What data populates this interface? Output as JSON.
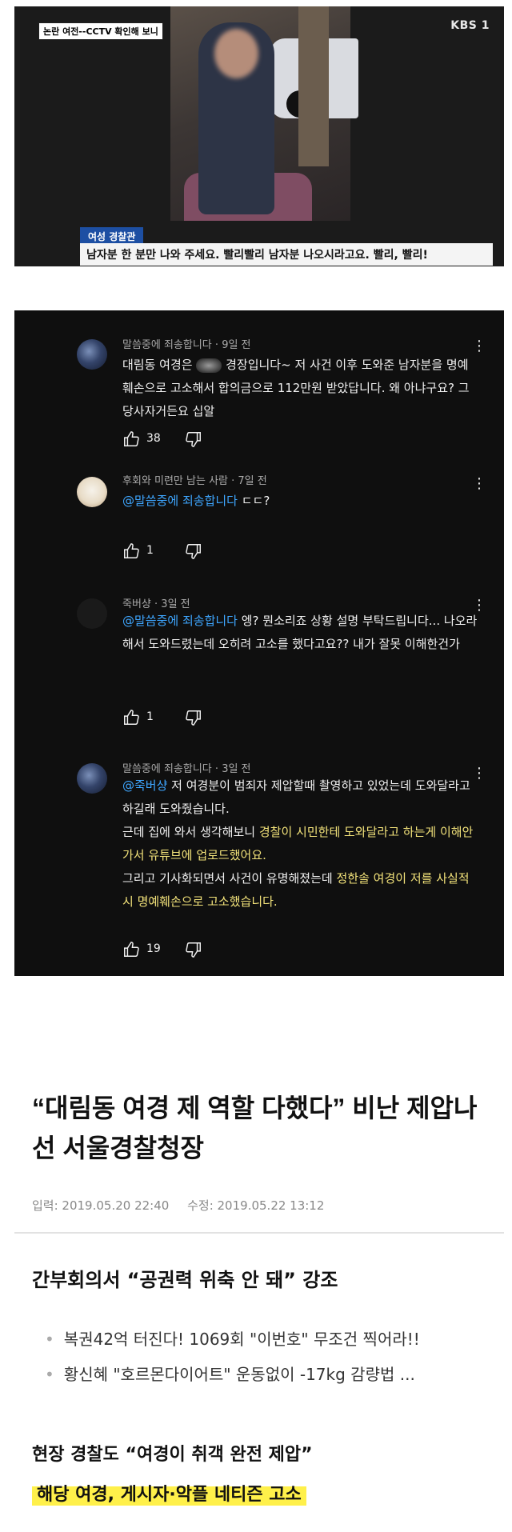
{
  "tv": {
    "tag": "논란 여전--CCTV 확인해 보니",
    "logo": "KBS 1",
    "caption_label": "여성 경찰관",
    "caption": "남자분 한 분만 나와 주세요. 빨리빨리 남자분 나오시라고요. 빨리, 빨리!"
  },
  "comments": [
    {
      "author": "말씀중에 죄송합니다",
      "time": "9일 전",
      "text_a": "대림동 여경은 ",
      "text_b": " 경장입니다~ 저 사건 이후 도와준 남자분을 명예훼손으로 고소해서 합의금으로 112만원 받았답니다. 왜 아냐구요? 그 당사자거든요 십알",
      "likes": "38"
    },
    {
      "author": "후회와 미련만 남는 사람",
      "time": "7일 전",
      "mention": "@말씀중에 죄송합니다",
      "text": " ㄷㄷ?",
      "likes": "1"
    },
    {
      "author": "죽버샹",
      "time": "3일 전",
      "mention": "@말씀중에 죄송합니다",
      "text": " 엥? 뭔소리죠 상황 설명 부탁드립니다... 나오라해서 도와드렸는데 오히려 고소를 했다고요?? 내가 잘못 이해한건가",
      "likes": "1"
    },
    {
      "author": "말씀중에 죄송합니다",
      "time": "3일 전",
      "mention": "@죽버샹",
      "text_1": " 저 여경분이 범죄자 제압할때 촬영하고 있었는데 도와달라고 하길래 도와줬습니다.",
      "text_2a": "근데 집에 와서 생각해보니 ",
      "text_2b": "경찰이 시민한테 도와달라고 하는게 이해안가서 유튜브에 업로드했어요.",
      "text_3a": "그리고 기사화되면서 사건이 유명해졌는데 ",
      "text_3b": "정한솔 여경이 저를 사실적시 명예훼손으로 고소했습니다.",
      "likes": "19"
    }
  ],
  "article": {
    "title": "“대림동 여경 제 역할 다했다” 비난 제압나선 서울경찰청장",
    "date_input": "입력: 2019.05.20 22:40",
    "date_edit": "수정: 2019.05.22 13:12",
    "subtitle": "간부회의서 “공권력 위축 안 돼” 강조",
    "links": [
      "복권42억 터진다! 1069회 \"이번호\" 무조건 찍어라!!",
      "황신혜 \"호르몬다이어트\" 운동없이 -17kg 감량법 ..."
    ],
    "heading_2": "현장 경찰도 “여경이 취객 완전 제압”",
    "heading_3": "해당 여경, 게시자·악플 네티즌 고소"
  }
}
